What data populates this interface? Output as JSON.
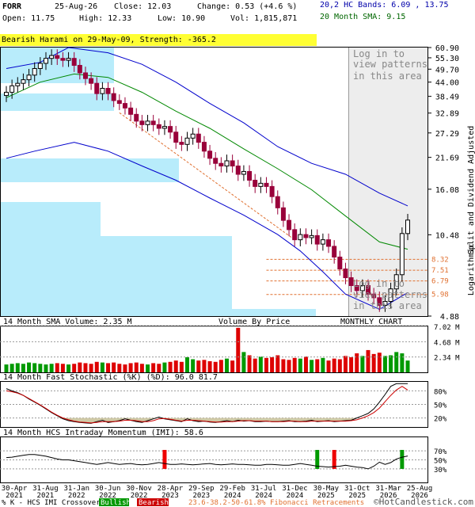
{
  "header": {
    "symbol": "FORR",
    "date": "25-Aug-26",
    "close": "Close: 12.03",
    "change": "Change: 0.53 (+4.6 %)",
    "open": "Open: 11.75",
    "high": "High: 12.33",
    "low": "Low: 10.90",
    "volume": "Vol: 1,815,871",
    "bands": "20,2 HC Bands: 6.09 , 13.75",
    "sma": "20 Month SMA: 9.15"
  },
  "pattern_banner": "Bearish Harami on 29-May-09, Strength: -365.2",
  "overlay_note": {
    "lines": [
      "Log in to",
      "view patterns",
      "in this area"
    ]
  },
  "right_axis_label": "Split and Dividend Adjusted",
  "scale_label": "Logarithmic",
  "panel_titles": {
    "volume": "14 Month SMA Volume: 2.35 M",
    "volume_by_price": "Volume By Price",
    "period": "MONTHLY CHART",
    "stochastic": "14 Month Fast Stochastic (%K) (%D): 96.0  81.7",
    "momentum": "14 Month HCS Intraday Momentum (IMI): 58.6"
  },
  "footer": {
    "legend_prefix": "% K - HCS IMI Crossover:",
    "bullish": "Bullish",
    "bearish": "Bearish",
    "fib": "23.6-38.2-50-61.8% Fibonacci Retracements",
    "copyright": "©HotCandlestick.com"
  },
  "colors": {
    "bull": "#009900",
    "bear": "#99003a",
    "upper_band": "#0000cc",
    "sma": "#008800",
    "vbp": "#b8ecfb",
    "fib": "#e07030"
  },
  "chart_data": {
    "type": "candlestick",
    "price_axis": {
      "scale": "log",
      "ticks": [
        60.9,
        55.3,
        49.7,
        44.0,
        38.49,
        32.89,
        27.29,
        21.69,
        16.08,
        10.48,
        4.88
      ]
    },
    "x_ticks": [
      "30-Apr 2021",
      "31-Aug 2021",
      "31-Jan 2022",
      "30-Jun 2022",
      "30-Nov 2022",
      "28-Apr 2023",
      "29-Sep 2023",
      "29-Feb 2024",
      "31-Jul 2024",
      "31-Dec 2024",
      "30-May 2025",
      "31-Oct 2025",
      "31-Mar 2026",
      "25-Aug 2026"
    ],
    "fib_levels": [
      "8.32",
      "7.51",
      "6.79",
      "5.98"
    ],
    "closes": [
      40.0,
      42.5,
      43.5,
      45.0,
      47.0,
      50.0,
      52.5,
      55.0,
      56.5,
      55.0,
      54.0,
      55.0,
      51.5,
      48.0,
      45.5,
      43.5,
      39.5,
      41.5,
      39.5,
      37.0,
      36.0,
      34.5,
      32.5,
      30.5,
      29.5,
      30.5,
      29.5,
      28.5,
      29.0,
      27.5,
      25.0,
      24.5,
      26.0,
      27.0,
      25.0,
      23.0,
      21.5,
      20.5,
      20.0,
      21.0,
      20.0,
      18.5,
      19.0,
      17.5,
      16.5,
      17.0,
      16.5,
      15.0,
      13.5,
      12.0,
      11.0,
      10.0,
      10.5,
      10.2,
      10.4,
      9.6,
      10.0,
      9.4,
      8.5,
      7.6,
      7.0,
      6.5,
      6.2,
      6.5,
      6.0,
      5.8,
      5.4,
      5.6,
      6.3,
      7.2,
      10.6,
      12.03
    ],
    "upper_band_points": [
      [
        0,
        50.0
      ],
      [
        6,
        53.0
      ],
      [
        11,
        60.9
      ],
      [
        18,
        58.0
      ],
      [
        24,
        52.0
      ],
      [
        30,
        44.0
      ],
      [
        36,
        36.0
      ],
      [
        42,
        30.0
      ],
      [
        48,
        24.0
      ],
      [
        54,
        20.5
      ],
      [
        60,
        18.5
      ],
      [
        66,
        15.5
      ],
      [
        71,
        13.75
      ]
    ],
    "lower_band_points": [
      [
        0,
        21.5
      ],
      [
        5,
        23.0
      ],
      [
        12,
        25.0
      ],
      [
        18,
        23.0
      ],
      [
        24,
        20.0
      ],
      [
        30,
        17.5
      ],
      [
        36,
        14.8
      ],
      [
        42,
        12.6
      ],
      [
        48,
        10.5
      ],
      [
        52,
        9.0
      ],
      [
        56,
        7.4
      ],
      [
        60,
        6.0
      ],
      [
        66,
        5.2
      ],
      [
        71,
        6.09
      ]
    ],
    "sma_points": [
      [
        0,
        38.0
      ],
      [
        6,
        44.0
      ],
      [
        12,
        47.5
      ],
      [
        18,
        46.0
      ],
      [
        24,
        40.0
      ],
      [
        30,
        33.5
      ],
      [
        36,
        28.5
      ],
      [
        42,
        23.5
      ],
      [
        48,
        19.5
      ],
      [
        54,
        16.0
      ],
      [
        60,
        12.5
      ],
      [
        66,
        9.8
      ],
      [
        71,
        9.15
      ]
    ],
    "fib_window": {
      "start": 46,
      "end": 71
    },
    "volume_axis": {
      "ticks": [
        "7.02 M",
        "4.68 M",
        "2.34 M"
      ],
      "max": 7.02
    },
    "volume": [
      1.2,
      1.3,
      1.4,
      1.3,
      1.5,
      1.4,
      1.3,
      1.2,
      1.3,
      1.4,
      1.3,
      1.2,
      1.3,
      1.5,
      1.4,
      1.3,
      1.6,
      1.5,
      1.4,
      1.5,
      1.3,
      1.2,
      1.4,
      1.5,
      1.3,
      1.2,
      1.4,
      1.3,
      1.5,
      1.6,
      1.8,
      1.6,
      2.3,
      2.0,
      1.8,
      1.9,
      1.7,
      1.6,
      1.9,
      2.1,
      1.8,
      6.8,
      3.1,
      2.6,
      2.1,
      2.4,
      2.2,
      2.3,
      2.6,
      2.0,
      1.9,
      2.2,
      2.1,
      2.4,
      1.9,
      2.0,
      2.2,
      1.8,
      2.1,
      2.0,
      2.5,
      2.3,
      2.9,
      2.5,
      3.4,
      2.8,
      3.0,
      2.5,
      2.6,
      3.1,
      2.9,
      1.8
    ],
    "stoch_axis": {
      "ticks": [
        "80%",
        "50%",
        "20%"
      ]
    },
    "stoch_k": [
      85,
      80,
      76,
      70,
      62,
      55,
      48,
      40,
      32,
      25,
      18,
      14,
      12,
      10,
      9,
      8,
      12,
      15,
      10,
      12,
      14,
      18,
      15,
      12,
      10,
      14,
      18,
      22,
      18,
      16,
      14,
      12,
      18,
      14,
      12,
      13,
      11,
      10,
      12,
      14,
      12,
      15,
      13,
      14,
      12,
      12,
      13,
      12,
      12,
      13,
      14,
      12,
      12,
      13,
      15,
      12,
      13,
      14,
      12,
      13,
      14,
      15,
      20,
      25,
      30,
      40,
      55,
      72,
      90,
      96,
      96,
      96
    ],
    "stoch_d": [
      80,
      78,
      75,
      70,
      63,
      56,
      49,
      41,
      33,
      26,
      20,
      16,
      13,
      11,
      10,
      9,
      10,
      12,
      12,
      12,
      13,
      15,
      15,
      14,
      12,
      12,
      14,
      18,
      19,
      17,
      15,
      13,
      15,
      15,
      14,
      13,
      12,
      11,
      11,
      12,
      12,
      13,
      14,
      14,
      13,
      13,
      13,
      12,
      12,
      12,
      13,
      13,
      12,
      12,
      13,
      13,
      13,
      13,
      13,
      13,
      13,
      14,
      16,
      20,
      25,
      32,
      42,
      56,
      70,
      82,
      90,
      81.7
    ],
    "momentum_axis": {
      "ticks": [
        "70%",
        "50%",
        "30%"
      ]
    },
    "momentum": [
      55,
      56,
      58,
      60,
      62,
      62,
      60,
      58,
      55,
      52,
      50,
      50,
      48,
      46,
      44,
      42,
      40,
      42,
      44,
      42,
      40,
      41,
      42,
      40,
      39,
      40,
      42,
      44,
      42,
      40,
      40,
      41,
      40,
      39,
      40,
      41,
      42,
      40,
      39,
      40,
      41,
      40,
      40,
      39,
      38,
      38,
      40,
      40,
      39,
      38,
      38,
      40,
      42,
      40,
      38,
      36,
      35,
      34,
      35,
      36,
      38,
      36,
      34,
      33,
      30,
      36,
      45,
      40,
      44,
      52,
      56,
      58.6
    ],
    "crossovers": [
      {
        "i": 28,
        "type": "bearish"
      },
      {
        "i": 55,
        "type": "bullish"
      },
      {
        "i": 58,
        "type": "bearish"
      },
      {
        "i": 118,
        "type": "bullish"
      }
    ]
  }
}
